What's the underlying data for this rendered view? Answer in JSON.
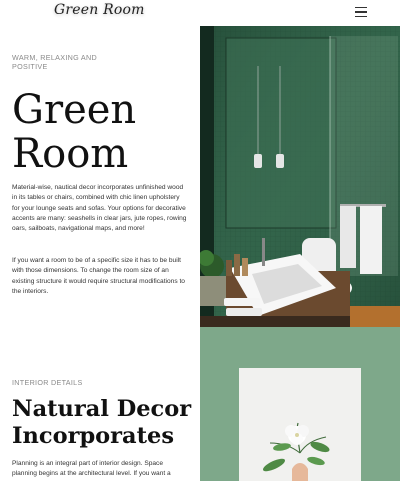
{
  "header": {
    "logo_text": "Green Room",
    "menu_icon": "hamburger-menu-icon"
  },
  "hero": {
    "eyebrow": "WARM, RELAXING AND POSITIVE",
    "title_line1": "Green",
    "title_line2": "Room",
    "paragraph1": "Material-wise, nautical decor incorporates unfinished wood in its tables or chairs, combined with chic linen upholstery for your lounge seats and sofas. Your options for decorative accents are many: seashells in clear jars, jute ropes, rowing oars, sailboats, navigational maps, and more!",
    "paragraph2": "If you want a room to be of a specific size it has to be built with those dimensions. To change the room size of an existing structure it would require structural modifications to the interiors."
  },
  "section2": {
    "eyebrow": "INTERIOR DETAILS",
    "title_line1": "Natural Decor",
    "title_line2": "Incorporates",
    "paragraph": "Planning is an integral part of interior design. Space planning begins at the architectural level. If you want a"
  },
  "colors": {
    "accent_green": "#2f6147",
    "sage_green": "#7ea88a"
  }
}
